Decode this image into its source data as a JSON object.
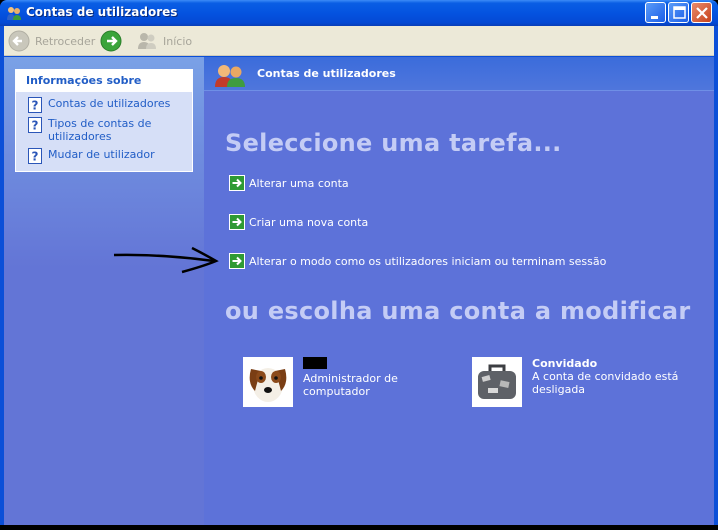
{
  "window": {
    "title": "Contas de utilizadores",
    "controls": {
      "minimize": "minimize",
      "maximize": "maximize",
      "close": "close"
    }
  },
  "toolbar": {
    "back_label": "Retroceder",
    "home_label": "Início"
  },
  "sidebar": {
    "panel_title": "Informações sobre",
    "items": [
      {
        "label": "Contas de utilizadores",
        "icon": "help-icon"
      },
      {
        "label": "Tipos de contas de utilizadores",
        "icon": "help-icon"
      },
      {
        "label": "Mudar de utilizador",
        "icon": "help-icon"
      }
    ]
  },
  "main": {
    "header_title": "Contas de utilizadores",
    "task_heading": "Seleccione uma tarefa...",
    "tasks": [
      "Alterar uma conta",
      "Criar uma nova conta",
      "Alterar o modo como os utilizadores iniciam ou terminam sessão"
    ],
    "account_heading": "ou escolha uma conta a modificar",
    "accounts": [
      {
        "name": "",
        "name_redacted": true,
        "description": "Administrador de computador",
        "picture": "dog"
      },
      {
        "name": "Convidado",
        "description": "A conta de convidado está desligada",
        "picture": "suitcase"
      }
    ]
  },
  "colors": {
    "title_bar": "#0453e0",
    "main_background": "#5d72d9",
    "heading_text": "#c4ccf5",
    "link_text": "#215dc6",
    "task_icon_green": "#2f9a34"
  }
}
